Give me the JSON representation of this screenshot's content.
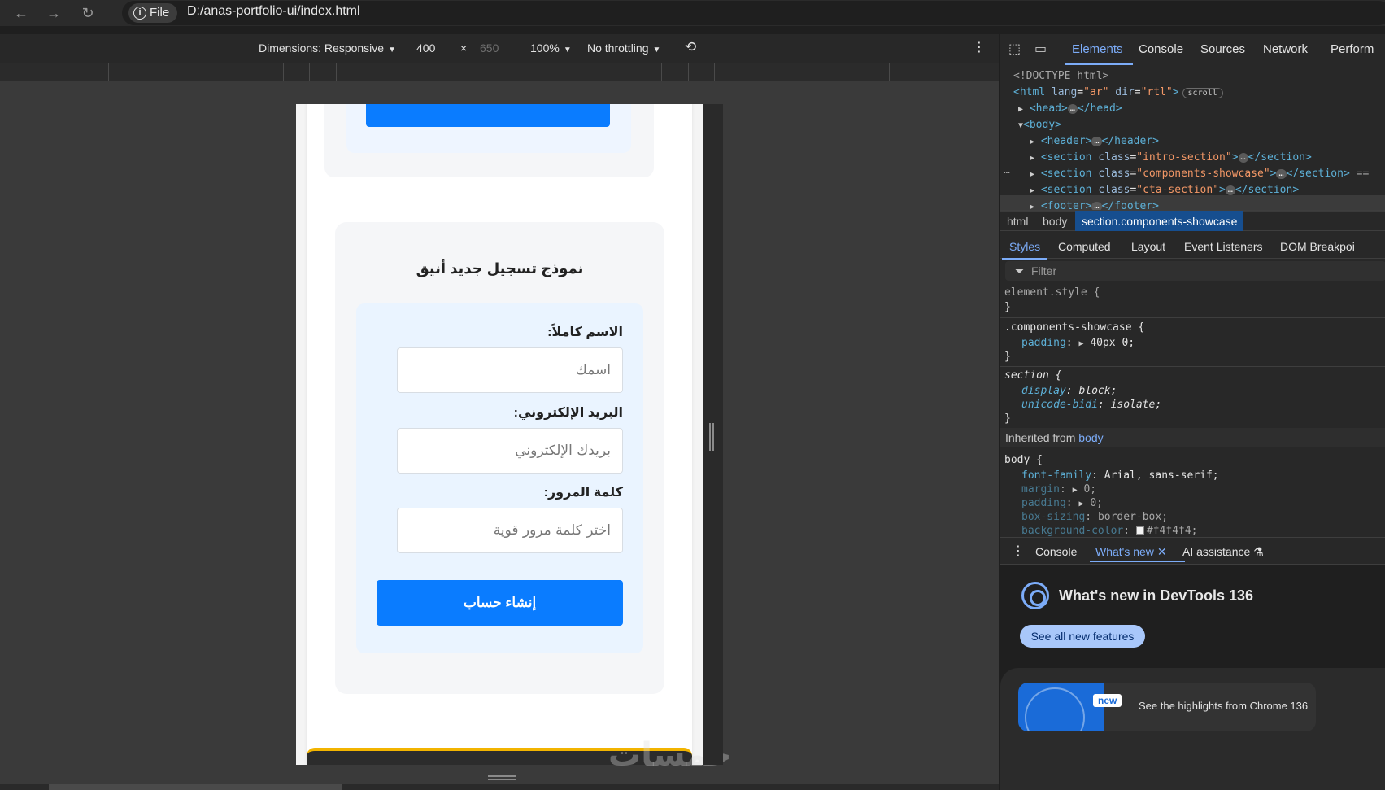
{
  "browser": {
    "file_chip": "File",
    "url": "D:/anas-portfolio-ui/index.html"
  },
  "device_toolbar": {
    "dimensions": "Dimensions: Responsive",
    "width": "400",
    "times": "×",
    "height": "650",
    "zoom": "100%",
    "throttling": "No throttling"
  },
  "page": {
    "showcase_title": "نموذج تسجيل جديد أنيق",
    "form": {
      "name_label": "الاسم كاملاً:",
      "name_placeholder": "اسمك",
      "email_label": "البريد الإلكتروني:",
      "email_placeholder": "بريدك الإلكتروني",
      "password_label": "كلمة المرور:",
      "password_placeholder": "اختر كلمة مرور قوية",
      "submit": "إنشاء حساب"
    },
    "watermark": "خمسات"
  },
  "devtools": {
    "tabs": [
      "Elements",
      "Console",
      "Sources",
      "Network",
      "Perform"
    ],
    "dom": {
      "doctype": "<!DOCTYPE html>",
      "html_open": "<html",
      "lang_attr": "lang",
      "lang_val": "\"ar\"",
      "dir_attr": "dir",
      "dir_val": "\"rtl\"",
      "scroll_badge": "scroll",
      "head": "<head>",
      "head_close": "</head>",
      "body": "<body>",
      "header": "<header>",
      "header_close": "</header>",
      "section_open": "<section",
      "class_attr": "class",
      "intro_val": "\"intro-section\"",
      "components_val": "\"components-showcase\"",
      "cta_val": "\"cta-section\"",
      "section_close": "</section>",
      "eq": "==",
      "footer": "<footer>",
      "footer_close": "</footer>",
      "ellipsis": "…",
      "gutter_dots": "…"
    },
    "breadcrumbs": [
      "html",
      "body",
      "section.components-showcase"
    ],
    "sub_tabs": [
      "Styles",
      "Computed",
      "Layout",
      "Event Listeners",
      "DOM Breakpoi"
    ],
    "filter_placeholder": "Filter",
    "styles": {
      "element_style": "element.style {",
      "close": "}",
      "rule1_selector": ".components-showcase {",
      "rule1_prop": "padding",
      "rule1_val": "40px 0;",
      "rule2_selector": "section {",
      "rule2_prop1": "display",
      "rule2_val1": "block;",
      "rule2_prop2": "unicode-bidi",
      "rule2_val2": "isolate;",
      "inherited_label": "Inherited from",
      "inherited_from": "body",
      "rule3_selector": "body {",
      "rule3_props": [
        {
          "prop": "font-family",
          "val": "Arial, sans-serif;"
        },
        {
          "prop": "margin",
          "val": "0;"
        },
        {
          "prop": "padding",
          "val": "0;"
        },
        {
          "prop": "box-sizing",
          "val": "border-box;"
        },
        {
          "prop": "background-color",
          "val": "#f4f4f4;"
        }
      ]
    },
    "drawer_tabs": [
      "Console",
      "What's new",
      "AI assistance"
    ],
    "whats_new": {
      "title": "What's new in DevTools 136",
      "button": "See all new features",
      "badge": "new",
      "highlight": "See the highlights from Chrome 136"
    }
  },
  "colors": {
    "accent_blue": "#0a7cff",
    "devtools_accent": "#7cacf8",
    "cta_yellow": "#f2b400"
  }
}
